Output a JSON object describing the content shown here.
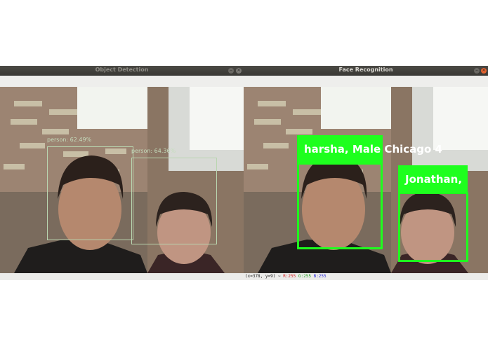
{
  "windows": {
    "object_detection": {
      "title": "Object Detection",
      "detections": [
        {
          "label": "person: 62.49%"
        },
        {
          "label": "person: 64.36%"
        }
      ]
    },
    "face_recognition": {
      "title": "Face Recognition",
      "faces": [
        {
          "label": "harsha, Male Chicago 4"
        },
        {
          "label": "Jonathan,"
        }
      ],
      "status": {
        "coords": "(x=378, y=9) ~",
        "r": "R:255",
        "g": "G:255",
        "b": "B:255"
      }
    }
  },
  "colors": {
    "detection_box": "#b9d6b0",
    "recognition_box": "#1eff1e",
    "titlebar": "#3c3b37"
  },
  "icons": [
    "minimize-icon",
    "close-icon"
  ]
}
